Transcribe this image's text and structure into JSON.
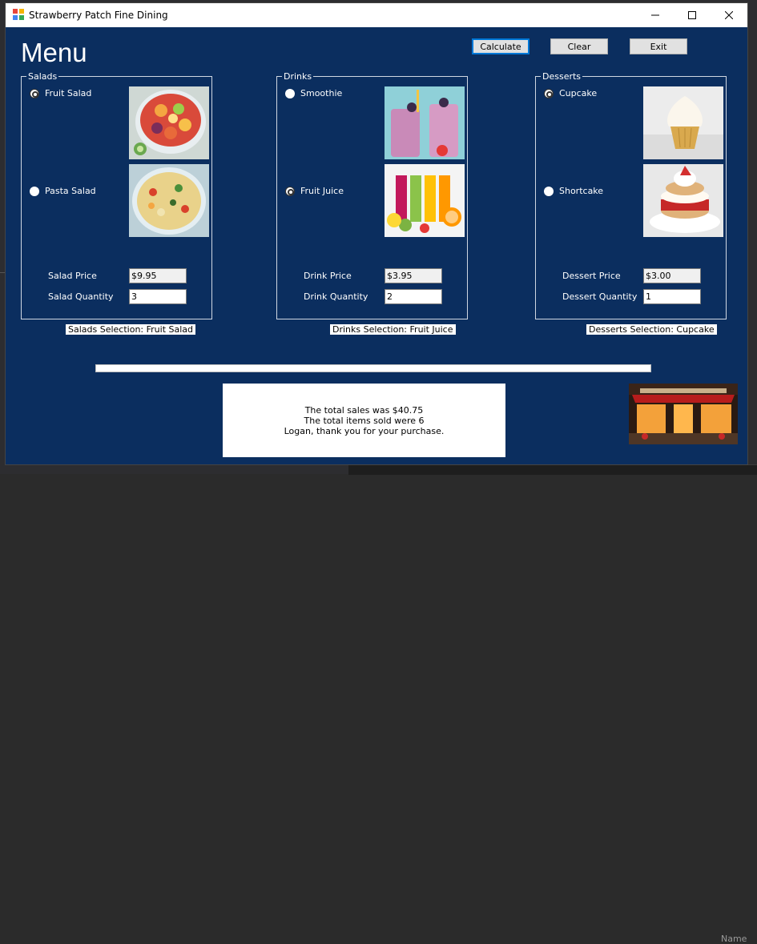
{
  "window": {
    "title": "Strawberry Patch Fine Dining"
  },
  "header": {
    "title": "Menu"
  },
  "toolbar": {
    "calculate_label": "Calculate",
    "clear_label": "Clear",
    "exit_label": "Exit"
  },
  "salads": {
    "legend": "Salads",
    "options": [
      {
        "label": "Fruit Salad",
        "checked": true
      },
      {
        "label": "Pasta Salad",
        "checked": false
      }
    ],
    "price_label": "Salad Price",
    "price_value": "$9.95",
    "quantity_label": "Salad Quantity",
    "quantity_value": "3",
    "selection_text": "Salads Selection: Fruit Salad"
  },
  "drinks": {
    "legend": "Drinks",
    "options": [
      {
        "label": "Smoothie",
        "checked": false
      },
      {
        "label": "Fruit Juice",
        "checked": true
      }
    ],
    "price_label": "Drink Price",
    "price_value": "$3.95",
    "quantity_label": "Drink Quantity",
    "quantity_value": "2",
    "selection_text": "Drinks Selection: Fruit Juice"
  },
  "desserts": {
    "legend": "Desserts",
    "options": [
      {
        "label": "Cupcake",
        "checked": true
      },
      {
        "label": "Shortcake",
        "checked": false
      }
    ],
    "price_label": "Dessert Price",
    "price_value": "$3.00",
    "quantity_label": "Dessert Quantity",
    "quantity_value": "1",
    "selection_text": "Desserts Selection: Cupcake"
  },
  "progress": {
    "fraction": 0.0
  },
  "summary": {
    "lines": [
      "The total sales was $40.75",
      "The total items sold were 6",
      "Logan, thank you for your purchase."
    ]
  },
  "background": {
    "bottom_text": "Name"
  },
  "colors": {
    "form_bg": "#0b2e5f",
    "accent": "#0078d7"
  }
}
